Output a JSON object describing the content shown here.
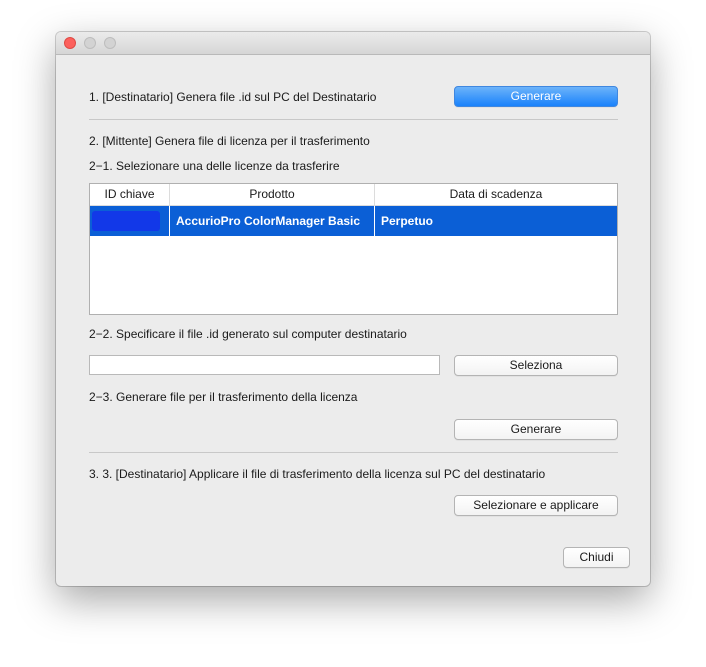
{
  "window": {
    "title": ""
  },
  "step1": {
    "label": "1. [Destinatario] Genera file .id sul PC del Destinatario",
    "button": "Generare"
  },
  "step2": {
    "label": "2. [Mittente] Genera file di licenza per il trasferimento",
    "sub1": "2−1. Selezionare una delle licenze da trasferire",
    "table": {
      "headers": [
        "ID chiave",
        "Prodotto",
        "Data di scadenza"
      ],
      "rows": [
        {
          "id": "",
          "product": "AccurioPro ColorManager Basic",
          "expiry": "Perpetuo",
          "selected": true
        }
      ]
    },
    "sub2": "2−2. Specificare il file .id generato sul computer destinatario",
    "file_input": {
      "value": "",
      "placeholder": ""
    },
    "select_button": "Seleziona",
    "sub3": "2−3. Generare file per il trasferimento della licenza",
    "generate_button": "Generare"
  },
  "step3": {
    "label": "3. 3. [Destinatario] Applicare il file di trasferimento della licenza sul PC del destinatario",
    "button": "Selezionare e applicare"
  },
  "close_button": "Chiudi",
  "colors": {
    "accent": "#1a82fb",
    "selection": "#0b5fd6"
  },
  "icons": {
    "close": "traffic-close-icon",
    "minimize": "traffic-minimize-icon",
    "zoom": "traffic-zoom-icon"
  }
}
